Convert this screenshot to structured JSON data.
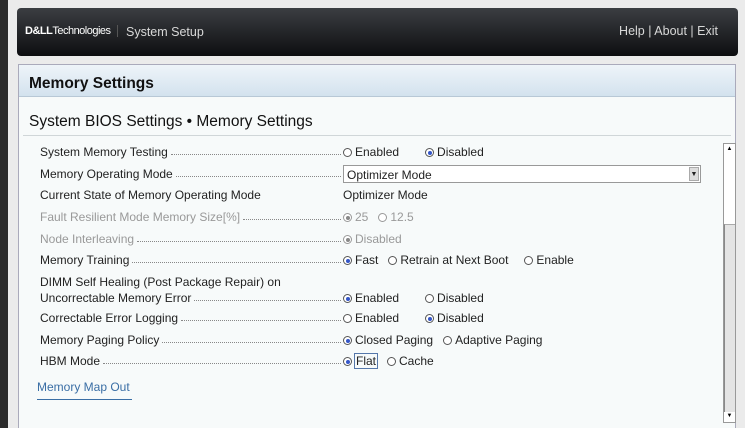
{
  "header": {
    "logo": "DELL Technologies",
    "logo_bold": "D&LL",
    "logo_rest": "Technologies",
    "title": "System Setup",
    "help": "Help",
    "about": "About",
    "exit": "Exit",
    "sep": " | "
  },
  "panel": {
    "title": "Memory Settings",
    "breadcrumb": "System BIOS Settings • Memory Settings"
  },
  "rows": [
    {
      "label": "System Memory Testing",
      "options": [
        "Enabled",
        "Disabled"
      ],
      "selected": "Disabled"
    },
    {
      "label": "Memory Operating Mode",
      "value": "Optimizer Mode"
    },
    {
      "label": "Current State of Memory Operating Mode",
      "value": "Optimizer Mode"
    },
    {
      "label": "Fault Resilient Mode Memory Size[%]",
      "options": [
        "25",
        "12.5"
      ],
      "selected": "25",
      "disabled": true
    },
    {
      "label": "Node Interleaving",
      "options": [
        "Disabled"
      ],
      "selected": "Disabled",
      "disabled": true
    },
    {
      "label": "Memory Training",
      "options": [
        "Fast",
        "Retrain at Next Boot",
        "Enable"
      ],
      "selected": "Fast"
    },
    {
      "label_line1": "DIMM Self Healing (Post Package Repair) on",
      "label": "Uncorrectable Memory Error",
      "options": [
        "Enabled",
        "Disabled"
      ],
      "selected": "Enabled"
    },
    {
      "label": "Correctable Error Logging",
      "options": [
        "Enabled",
        "Disabled"
      ],
      "selected": "Disabled"
    },
    {
      "label": "Memory Paging Policy",
      "options": [
        "Closed Paging",
        "Adaptive Paging"
      ],
      "selected": "Closed Paging"
    },
    {
      "label": "HBM Mode",
      "options": [
        "Flat",
        "Cache"
      ],
      "selected": "Flat"
    }
  ],
  "link": "Memory Map Out",
  "colors": {
    "accent": "#3456c8",
    "link": "#3a6ea5"
  }
}
